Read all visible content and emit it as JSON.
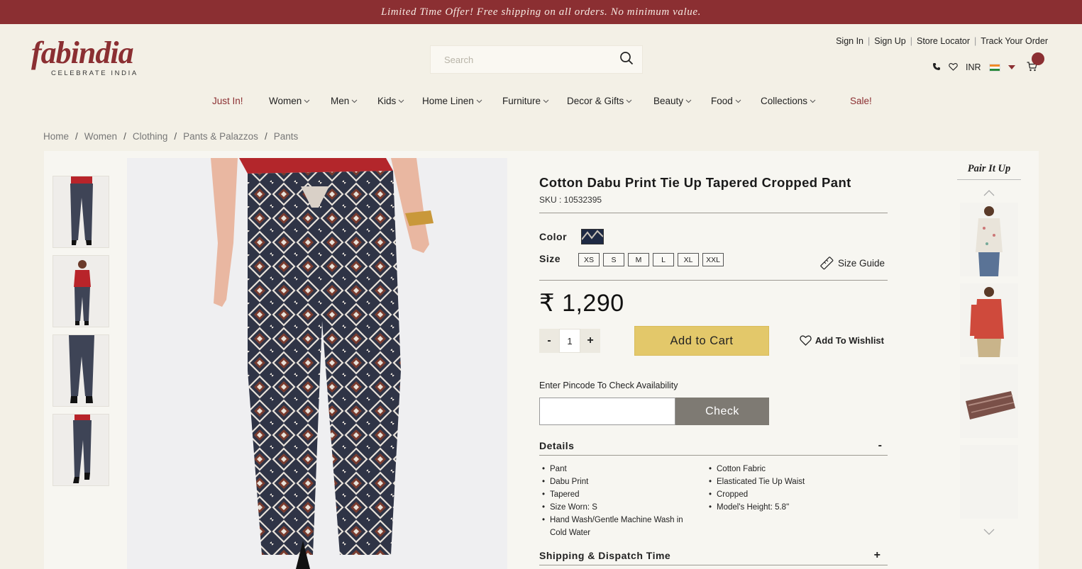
{
  "promo_bar": {
    "text": "Limited Time Offer! Free shipping on all orders. No minimum value."
  },
  "brand": {
    "logo_text": "fabindia",
    "tagline": "CELEBRATE INDIA",
    "accent_color": "#8b2f32",
    "cta_color": "#e3c86a"
  },
  "search": {
    "placeholder": "Search",
    "icon": "search-icon"
  },
  "account_links": [
    "Sign In",
    "Sign Up",
    "Store Locator",
    "Track Your Order"
  ],
  "utility": {
    "currency": "INR",
    "icons": [
      "phone-icon",
      "heart-icon",
      "india-flag-icon",
      "caret-down-icon",
      "cart-icon"
    ]
  },
  "nav": [
    {
      "label": "Just In!"
    },
    {
      "label": "Women"
    },
    {
      "label": "Men"
    },
    {
      "label": "Kids"
    },
    {
      "label": "Home Linen"
    },
    {
      "label": "Furniture"
    },
    {
      "label": "Decor & Gifts"
    },
    {
      "label": "Beauty"
    },
    {
      "label": "Food"
    },
    {
      "label": "Collections"
    },
    {
      "label": "Sale!"
    }
  ],
  "breadcrumb": [
    "Home",
    "Women",
    "Clothing",
    "Pants & Palazzos",
    "Pants"
  ],
  "product": {
    "title": "Cotton Dabu Print Tie Up Tapered Cropped Pant",
    "sku_label": "SKU : 10532395",
    "color_label": "Color",
    "size_label": "Size",
    "sizes": [
      "XS",
      "S",
      "M",
      "L",
      "XL",
      "XXL"
    ],
    "size_guide": "Size Guide",
    "price": "₹ 1,290",
    "quantity": "1",
    "qty_minus": "-",
    "qty_plus": "+",
    "add_to_cart": "Add to Cart",
    "add_to_wishlist": "Add To Wishlist",
    "pincode_label": "Enter Pincode To Check Availability",
    "pincode_value": "",
    "check_button": "Check",
    "details_label": "Details",
    "details_toggle": "-",
    "details_left": [
      "Pant",
      "Dabu Print",
      "Tapered",
      "Size Worn: S",
      "Hand Wash/Gentle Machine Wash in Cold Water"
    ],
    "details_right": [
      "Cotton Fabric",
      "Elasticated Tie Up Waist",
      "Cropped",
      "Model's Height: 5.8\""
    ],
    "shipping_label": "Shipping & Dispatch Time",
    "shipping_toggle": "+"
  },
  "pair_it_up": {
    "title": "Pair It Up",
    "up_icon": "chevron-up-icon",
    "down_icon": "chevron-down-icon"
  }
}
